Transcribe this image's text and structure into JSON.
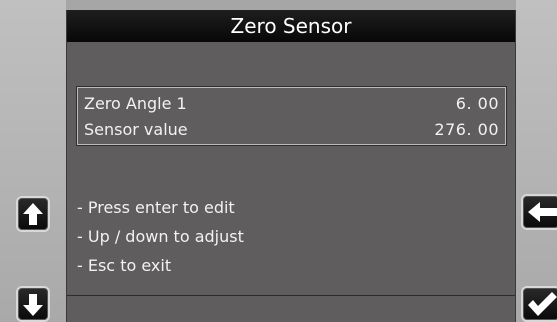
{
  "screen": {
    "title": "Zero Sensor"
  },
  "params": [
    {
      "label": "Zero Angle 1",
      "value": "6. 00"
    },
    {
      "label": "Sensor value",
      "value": "276. 00"
    }
  ],
  "instructions": [
    "- Press enter to edit",
    "- Up / down to adjust",
    "- Esc to exit"
  ],
  "buttons": {
    "up": "arrow-up-icon",
    "down": "arrow-down-icon",
    "back": "arrow-left-icon",
    "ok": "checkmark-icon"
  },
  "colors": {
    "screen_bg": "#5f5d5d",
    "titlebar_bg": "#0f0f0f",
    "bezel": "#b3b3b3",
    "text": "#f2f2f2"
  }
}
